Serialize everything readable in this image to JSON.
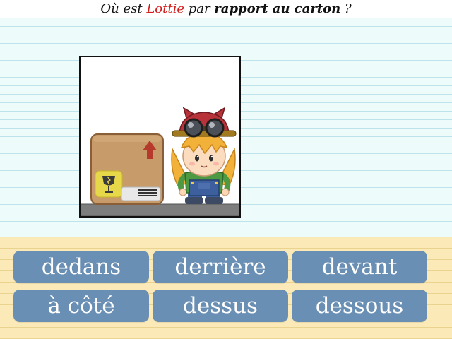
{
  "question": {
    "part1": "Où est ",
    "name": "Lottie",
    "part2": " par ",
    "bold": "rapport au carton",
    "part3": " ?"
  },
  "scene": {
    "character": "Lottie",
    "object": "carton",
    "position": "à côté"
  },
  "answers": [
    "dedans",
    "derrière",
    "devant",
    "à côté",
    "dessus",
    "dessous"
  ],
  "colors": {
    "button": "#6a8fb4",
    "highlight_name": "#d41c1c",
    "paper": "#eefbfb",
    "answer_area": "#fbeab8"
  }
}
